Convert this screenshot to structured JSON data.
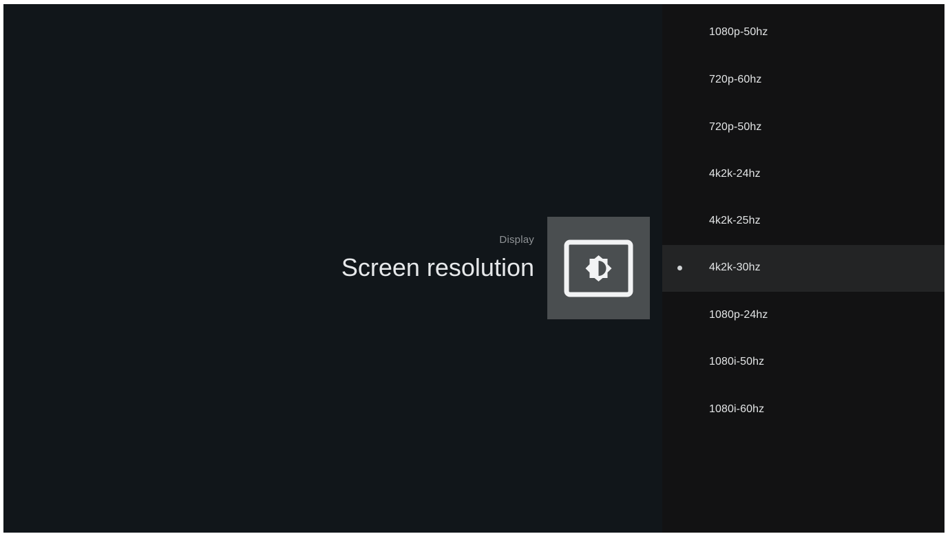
{
  "header": {
    "breadcrumb": "Display",
    "title": "Screen resolution",
    "icon": "display-brightness-icon"
  },
  "options": {
    "selected_index": 5,
    "items": [
      {
        "label": "1080p-50hz",
        "selected": false
      },
      {
        "label": "720p-60hz",
        "selected": false
      },
      {
        "label": "720p-50hz",
        "selected": false
      },
      {
        "label": "4k2k-24hz",
        "selected": false
      },
      {
        "label": "4k2k-25hz",
        "selected": false
      },
      {
        "label": "4k2k-30hz",
        "selected": true
      },
      {
        "label": "1080p-24hz",
        "selected": false
      },
      {
        "label": "1080i-50hz",
        "selected": false
      },
      {
        "label": "1080i-60hz",
        "selected": false
      }
    ]
  },
  "colors": {
    "background": "#11161a",
    "list_background": "#121213",
    "selected_row": "#232425",
    "icon_tile": "#4a4e50",
    "text_primary": "#e6e8ea",
    "text_secondary": "#8f9396"
  }
}
